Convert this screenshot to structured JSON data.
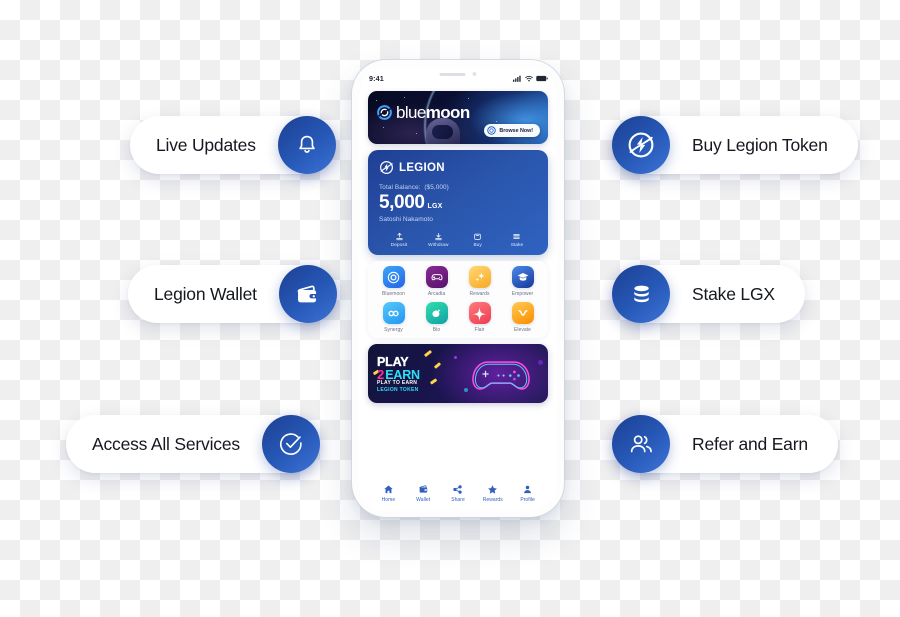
{
  "features": {
    "left": [
      {
        "label": "Live Updates",
        "icon": "bell-icon"
      },
      {
        "label": "Legion Wallet",
        "icon": "wallet-icon"
      },
      {
        "label": "Access All Services",
        "icon": "check-circle-icon"
      }
    ],
    "right": [
      {
        "label": "Buy Legion Token",
        "icon": "legion-bolt-icon"
      },
      {
        "label": "Stake LGX",
        "icon": "coins-stack-icon"
      },
      {
        "label": "Refer and Earn",
        "icon": "users-icon"
      }
    ]
  },
  "phone": {
    "status_bar": {
      "time": "9:41",
      "icons": [
        "signal-icon",
        "wifi-icon",
        "battery-icon"
      ]
    },
    "bluemoon_banner": {
      "brand_first": "blue",
      "brand_second": "moon",
      "cta": "Browse Now!",
      "cta_icon": "bluemoon-logo-icon"
    },
    "legion_card": {
      "title": "LEGION",
      "logo_icon": "legion-bolt-icon",
      "balance_label": "Total Balance:",
      "balance_fiat": "($5,000)",
      "amount": "5,000",
      "currency": "LGX",
      "owner": "Satoshi Nakamoto",
      "actions": [
        {
          "label": "Deposit",
          "icon": "upload-icon"
        },
        {
          "label": "Withdraw",
          "icon": "download-icon"
        },
        {
          "label": "Buy",
          "icon": "bag-icon"
        },
        {
          "label": "Stake",
          "icon": "layers-icon"
        }
      ]
    },
    "apps": [
      {
        "label": "Bluemoon",
        "icon": "bluemoon-ring-icon",
        "color_from": "#3ca7f5",
        "color_to": "#2563e8"
      },
      {
        "label": "Arcadia",
        "icon": "gamepad-icon",
        "color_from": "#7b1e86",
        "color_to": "#5a1470"
      },
      {
        "label": "Rewards",
        "icon": "sparkle-icon",
        "color_from": "#ffd060",
        "color_to": "#f9a825"
      },
      {
        "label": "Empower",
        "icon": "graduation-cap-icon",
        "color_from": "#3f7fe0",
        "color_to": "#1b3f9b"
      },
      {
        "label": "Synergy",
        "icon": "infinity-icon",
        "color_from": "#4fc3f7",
        "color_to": "#2196f3"
      },
      {
        "label": "Bio",
        "icon": "leaf-hand-icon",
        "color_from": "#2bd9a8",
        "color_to": "#17a2a2"
      },
      {
        "label": "Flair",
        "icon": "four-point-star-icon",
        "color_from": "#ff6a6a",
        "color_to": "#ee3b53"
      },
      {
        "label": "Elevate",
        "icon": "checkmark-v-icon",
        "color_from": "#ffc244",
        "color_to": "#fb8c00"
      }
    ],
    "p2e_banner": {
      "play": "PLAY",
      "two": "2",
      "earn": "EARN",
      "sub_line1": "PLAY TO EARN",
      "sub_line2": "LEGION TOKEN",
      "art_icon": "neon-gamepad-icon"
    },
    "bottom_nav": [
      {
        "label": "Home",
        "icon": "home-icon"
      },
      {
        "label": "Wallet",
        "icon": "wallet-icon"
      },
      {
        "label": "Share",
        "icon": "share-icon"
      },
      {
        "label": "Rewards",
        "icon": "star-icon"
      },
      {
        "label": "Profile",
        "icon": "person-icon"
      }
    ]
  },
  "colors": {
    "brand_blue": "#2759b8",
    "deep_blue": "#1c3f92",
    "accent_cyan": "#2de0f5",
    "accent_pink": "#ff2e9a",
    "nav_blue": "#2f5fc0"
  }
}
